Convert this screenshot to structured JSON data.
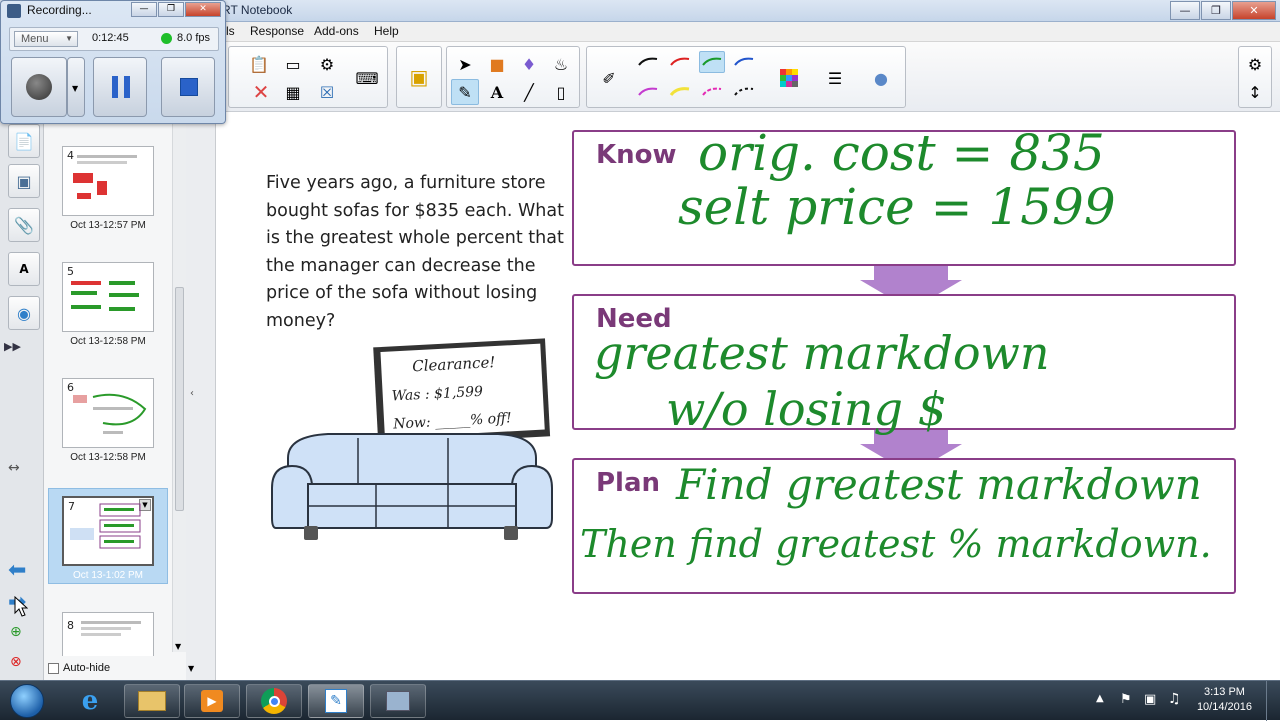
{
  "window": {
    "title": "RT Notebook"
  },
  "menu": {
    "items": [
      "ls",
      "Response",
      "Add-ons",
      "Help"
    ]
  },
  "recorder": {
    "title": "Recording...",
    "menu_label": "Menu",
    "elapsed": "0:12:45",
    "fps": "8.0 fps"
  },
  "pages": [
    {
      "number": "4",
      "timestamp": "Oct 13-12:57 PM"
    },
    {
      "number": "5",
      "timestamp": "Oct 13-12:58 PM"
    },
    {
      "number": "6",
      "timestamp": "Oct 13-12:58 PM"
    },
    {
      "number": "7",
      "timestamp": "Oct 13-1:02 PM"
    },
    {
      "number": "8",
      "timestamp": ""
    }
  ],
  "sidebar": {
    "autohide_label": "Auto-hide"
  },
  "problem": {
    "text": "Five years ago, a furniture store bought sofas for $835 each. What is the greatest whole percent that the manager can decrease the price of the sofa without losing money?"
  },
  "sign": {
    "heading": "Clearance!",
    "was": "Was : $1,599",
    "now": "Now: _____% off!"
  },
  "boxes": {
    "know": {
      "label": "Know",
      "line1": "orig. cost = 835",
      "line2": "selt price = 1599"
    },
    "need": {
      "label": "Need",
      "line1": "greatest markdown",
      "line2": "w/o losing $"
    },
    "plan": {
      "label": "Plan",
      "line1": "Find greatest markdown",
      "line2": "Then find greatest % markdown."
    }
  },
  "clock": {
    "time": "3:13 PM",
    "date": "10/14/2016"
  },
  "colors": {
    "box_border": "#8a3d88",
    "box_label": "#7a3978",
    "handwriting": "#1d8a2c",
    "arrow": "#a36cc4"
  }
}
